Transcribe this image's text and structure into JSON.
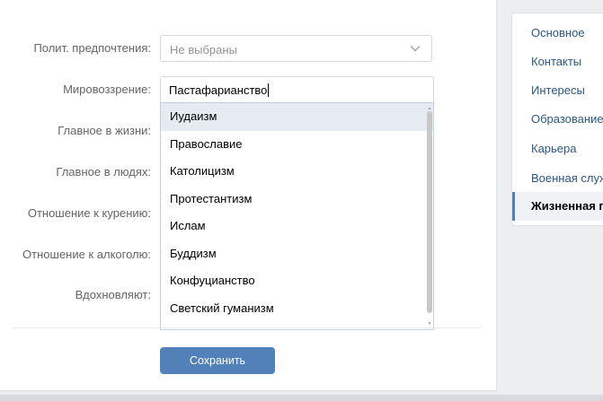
{
  "form": {
    "labels": {
      "political": "Полит. предпочтения:",
      "worldview": "Мировоззрение:",
      "main_in_life": "Главное в жизни:",
      "main_in_people": "Главное в людях:",
      "smoking": "Отношение к курению:",
      "alcohol": "Отношение к алкоголю:",
      "inspire": "Вдохновляют:"
    },
    "political_value": "Не выбраны",
    "worldview_value": "Пастафарианство",
    "worldview_options": [
      "Иудаизм",
      "Православие",
      "Католицизм",
      "Протестантизм",
      "Ислам",
      "Буддизм",
      "Конфуцианство",
      "Светский гуманизм"
    ],
    "highlighted_option_index": 0,
    "save_label": "Сохранить"
  },
  "sidebar": {
    "items": [
      {
        "label": "Основное"
      },
      {
        "label": "Контакты"
      },
      {
        "label": "Интересы"
      },
      {
        "label": "Образование"
      },
      {
        "label": "Карьера"
      },
      {
        "label": "Военная служба"
      },
      {
        "label": "Жизненная позиция"
      }
    ],
    "current_index": 6
  },
  "colors": {
    "accent": "#5181b8",
    "link": "#2a5885",
    "highlight": "#e5ebf1",
    "page_bg": "#edeef0"
  }
}
